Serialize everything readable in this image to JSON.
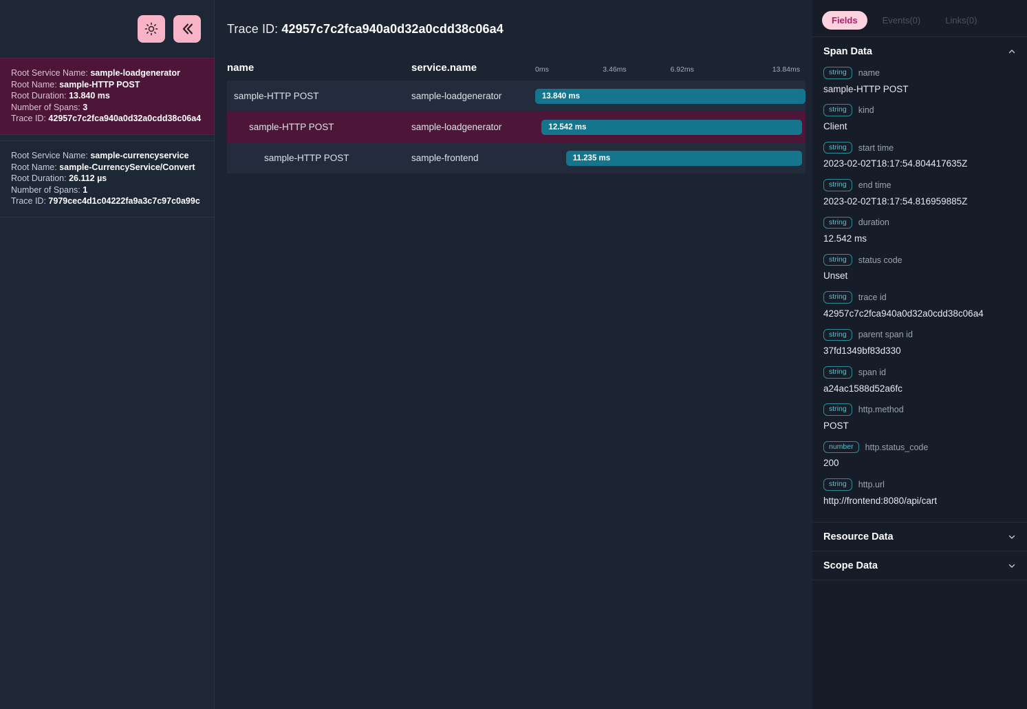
{
  "sidebar": {
    "theme_toggle_label": "light-mode",
    "collapse_label": "collapse-sidebar",
    "labels": {
      "root_service_name": "Root Service Name:",
      "root_name": "Root Name:",
      "root_duration": "Root Duration:",
      "number_of_spans": "Number of Spans:",
      "trace_id": "Trace ID:"
    },
    "traces": [
      {
        "root_service_name": "sample-loadgenerator",
        "root_name": "sample-HTTP POST",
        "root_duration": "13.840 ms",
        "number_of_spans": "3",
        "trace_id": "42957c7c2fca940a0d32a0cdd38c06a4",
        "selected": true
      },
      {
        "root_service_name": "sample-currencyservice",
        "root_name": "sample-CurrencyService/Convert",
        "root_duration": "26.112 µs",
        "number_of_spans": "1",
        "trace_id": "7979cec4d1c04222fa9a3c7c97c0a99c",
        "selected": false
      }
    ]
  },
  "header": {
    "trace_id_label": "Trace ID:",
    "trace_id": "42957c7c2fca940a0d32a0cdd38c06a4"
  },
  "waterfall": {
    "columns": {
      "name": "name",
      "service_name": "service.name"
    },
    "ticks": [
      {
        "label": "0ms",
        "pct": 0
      },
      {
        "label": "3.46ms",
        "pct": 25
      },
      {
        "label": "6.92ms",
        "pct": 50
      },
      {
        "label": "13.84ms",
        "pct": 100
      }
    ],
    "spans": [
      {
        "name": "sample-HTTP POST",
        "service_name": "sample-loadgenerator",
        "duration_label": "13.840 ms",
        "depth": 0,
        "offset_pct": 0,
        "width_pct": 100,
        "selected": false
      },
      {
        "name": "sample-HTTP POST",
        "service_name": "sample-loadgenerator",
        "duration_label": "12.542 ms",
        "depth": 1,
        "offset_pct": 2.4,
        "width_pct": 96.4,
        "selected": true
      },
      {
        "name": "sample-HTTP POST",
        "service_name": "sample-frontend",
        "duration_label": "11.235 ms",
        "depth": 2,
        "offset_pct": 11.4,
        "width_pct": 87.3,
        "selected": false
      }
    ]
  },
  "details": {
    "tabs": [
      {
        "label": "Fields",
        "active": true
      },
      {
        "label": "Events(0)",
        "active": false
      },
      {
        "label": "Links(0)",
        "active": false
      }
    ],
    "span_data": {
      "title": "Span Data",
      "expanded": true,
      "fields": [
        {
          "type": "string",
          "name": "name",
          "value": "sample-HTTP POST"
        },
        {
          "type": "string",
          "name": "kind",
          "value": "Client"
        },
        {
          "type": "string",
          "name": "start time",
          "value": "2023-02-02T18:17:54.804417635Z"
        },
        {
          "type": "string",
          "name": "end time",
          "value": "2023-02-02T18:17:54.816959885Z"
        },
        {
          "type": "string",
          "name": "duration",
          "value": "12.542 ms"
        },
        {
          "type": "string",
          "name": "status code",
          "value": "Unset"
        },
        {
          "type": "string",
          "name": "trace id",
          "value": "42957c7c2fca940a0d32a0cdd38c06a4"
        },
        {
          "type": "string",
          "name": "parent span id",
          "value": "37fd1349bf83d330"
        },
        {
          "type": "string",
          "name": "span id",
          "value": "a24ac1588d52a6fc"
        },
        {
          "type": "string",
          "name": "http.method",
          "value": "POST"
        },
        {
          "type": "number",
          "name": "http.status_code",
          "value": "200"
        },
        {
          "type": "string",
          "name": "http.url",
          "value": "http://frontend:8080/api/cart"
        }
      ]
    },
    "resource_data": {
      "title": "Resource Data",
      "expanded": false
    },
    "scope_data": {
      "title": "Scope Data",
      "expanded": false
    }
  },
  "colors": {
    "accent_pink": "#f9b3c7",
    "tab_active_bg": "#fbd2de",
    "tab_active_text": "#b5196b",
    "bar_teal": "#15758c",
    "selected_maroon": "#4d1639",
    "badge_border": "#2f8c9b"
  }
}
